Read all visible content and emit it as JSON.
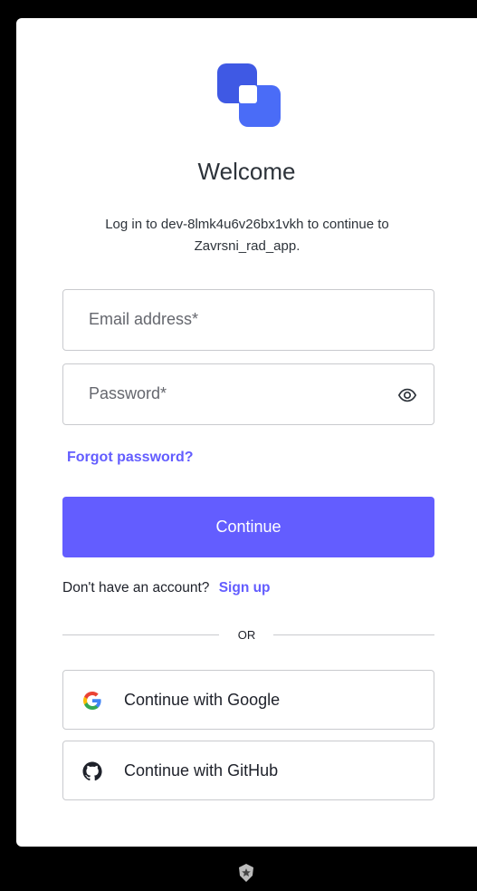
{
  "header": {
    "title": "Welcome",
    "subtitle": "Log in to dev-8lmk4u6v26bx1vkh to continue to Zavrsni_rad_app."
  },
  "form": {
    "email_placeholder": "Email address*",
    "password_placeholder": "Password*",
    "forgot_link": "Forgot password?",
    "continue_label": "Continue"
  },
  "signup": {
    "prompt": "Don't have an account?",
    "link": "Sign up"
  },
  "divider": {
    "label": "OR"
  },
  "social": {
    "google_label": "Continue with Google",
    "github_label": "Continue with GitHub"
  },
  "icons": {
    "logo": "brand-logo-icon",
    "password_toggle": "eye-icon",
    "google": "google-icon",
    "github": "github-icon",
    "footer": "auth0-badge-icon"
  },
  "colors": {
    "accent": "#635dff",
    "logo_dark": "#3f59e4",
    "logo_light": "#4a6cf7",
    "text": "#2d333a",
    "border": "#c9cace"
  }
}
